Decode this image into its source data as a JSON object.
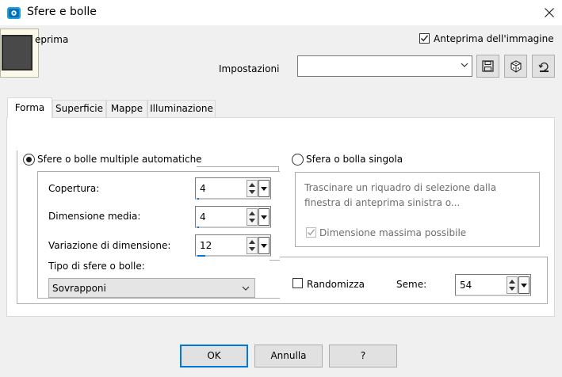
{
  "window": {
    "title": "Sfere e bolle",
    "close_icon": "close-icon",
    "app_icon": "paintshop-app-icon"
  },
  "preview": {
    "label_partial": "eprima",
    "show_image_preview_label": "Anteprima dell'immagine",
    "show_image_preview_checked": true
  },
  "presets": {
    "label": "Impostazioni",
    "value": "",
    "save_icon": "save-icon",
    "random_icon": "dice-icon",
    "reset_icon": "reset-icon"
  },
  "tabs": [
    {
      "label": "Forma",
      "active": true
    },
    {
      "label": "Superficie",
      "active": false
    },
    {
      "label": "Mappe",
      "active": false
    },
    {
      "label": "Illuminazione",
      "active": false
    }
  ],
  "form": {
    "multi_radio_label": "Sfere o bolle multiple automatiche",
    "multi_selected": true,
    "single_radio_label": "Sfera o bolla singola",
    "single_selected": false,
    "coverage": {
      "label": "Copertura:",
      "value": "4"
    },
    "avg_size": {
      "label": "Dimensione media:",
      "value": "4"
    },
    "size_variation": {
      "label": "Variazione di dimensione:",
      "value": "12"
    },
    "type_label": "Tipo di sfere o bolle:",
    "type_value": "Sovrapponi",
    "single_hint": "Trascinare un riquadro di selezione dalla finestra di anteprima sinistra o...",
    "max_size_label": "Dimensione massima possibile",
    "max_size_checked": true,
    "randomize_label": "Randomizza",
    "randomize_checked": false,
    "seed_label": "Seme:",
    "seed_value": "54"
  },
  "buttons": {
    "ok": "OK",
    "cancel": "Annulla",
    "help": "?"
  },
  "colors": {
    "accent": "#0078d7",
    "window_bg": "#f0f0f0",
    "disabled_text": "#6d6d6d"
  }
}
